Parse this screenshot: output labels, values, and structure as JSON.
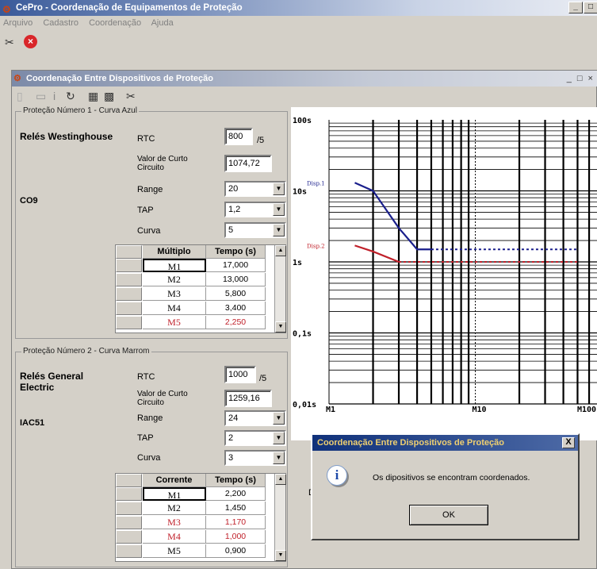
{
  "app": {
    "title": "CePro - Coordenação de Equipamentos de Proteção",
    "minimize": "_",
    "restore": "□"
  },
  "menu": [
    "Arquivo",
    "Cadastro",
    "Coordenação",
    "Ajuda"
  ],
  "toolbar_icons": [
    "settings-icon",
    "close-red-icon"
  ],
  "inner": {
    "title": "Coordenação Entre Dispositivos de Proteção",
    "controls": "_ □ ×"
  },
  "inner_toolbar_icons": [
    "new-icon",
    "save-icon",
    "info-icon",
    "refresh-icon",
    "chart-icon",
    "chart2-icon",
    "settings-icon"
  ],
  "prot1": {
    "legend": "Proteção Número 1 - Curva Azul",
    "brand": "Relés Westinghouse",
    "model": "CO9",
    "rtc_label": "RTC",
    "rtc_value": "800",
    "rtc_suffix": "/5",
    "curto_label": "Valor de Curto Circuito",
    "curto_value": "1074,72",
    "range_label": "Range",
    "range_value": "20",
    "tap_label": "TAP",
    "tap_value": "1,2",
    "curva_label": "Curva",
    "curva_value": "5",
    "table": {
      "headers": [
        "Múltiplo",
        "Tempo (s)"
      ],
      "rows": [
        {
          "m": "M1",
          "t": "17,000"
        },
        {
          "m": "M2",
          "t": "13,000"
        },
        {
          "m": "M3",
          "t": "5,800"
        },
        {
          "m": "M4",
          "t": "3,400"
        },
        {
          "m": "M5",
          "t": "2,250"
        }
      ]
    }
  },
  "prot2": {
    "legend": "Proteção Número 2 - Curva Marrom",
    "brand": "Relés General Electric",
    "model": "IAC51",
    "rtc_label": "RTC",
    "rtc_value": "1000",
    "rtc_suffix": "/5",
    "curto_label": "Valor de Curto Circuito",
    "curto_value": "1259,16",
    "range_label": "Range",
    "range_value": "24",
    "tap_label": "TAP",
    "tap_value": "2",
    "curva_label": "Curva",
    "curva_value": "3",
    "table": {
      "headers": [
        "Corrente",
        "Tempo (s)"
      ],
      "rows": [
        {
          "m": "M1",
          "t": "2,200"
        },
        {
          "m": "M2",
          "t": "1,450"
        },
        {
          "m": "M3",
          "t": "1,170"
        },
        {
          "m": "M4",
          "t": "1,000"
        },
        {
          "m": "M5",
          "t": "0,900"
        }
      ]
    }
  },
  "chart": {
    "y_ticks": [
      "100s",
      "10s",
      "1s",
      "0,1s",
      "0,01s"
    ],
    "x_ticks": [
      "M1",
      "M10",
      "M100"
    ],
    "disp1": "Disp.1",
    "disp2": "Disp.2"
  },
  "chart_data": {
    "type": "line",
    "x_scale": "log",
    "y_scale": "log",
    "xlim": [
      "M1",
      "M100"
    ],
    "ylim": [
      0.01,
      100
    ],
    "series": [
      {
        "name": "Disp.1",
        "color": "#1a1f8c",
        "x": [
          1.5,
          2,
          3,
          4,
          5,
          50
        ],
        "y": [
          13,
          10,
          3,
          1.5,
          1.5,
          1.5
        ]
      },
      {
        "name": "Disp.2",
        "color": "#c0202a",
        "x": [
          1.5,
          2,
          3,
          50
        ],
        "y": [
          1.7,
          1.4,
          1,
          1
        ]
      }
    ]
  },
  "bottom_label": "Da",
  "dialog": {
    "title": "Coordenação Entre Dispositivos de Proteção",
    "close": "X",
    "message": "Os dipositivos se encontram coordenados.",
    "ok": "OK"
  },
  "colors": {
    "blue_curve": "#1a1f8c",
    "red_curve": "#c0202a",
    "title_blue": "#10317a"
  }
}
